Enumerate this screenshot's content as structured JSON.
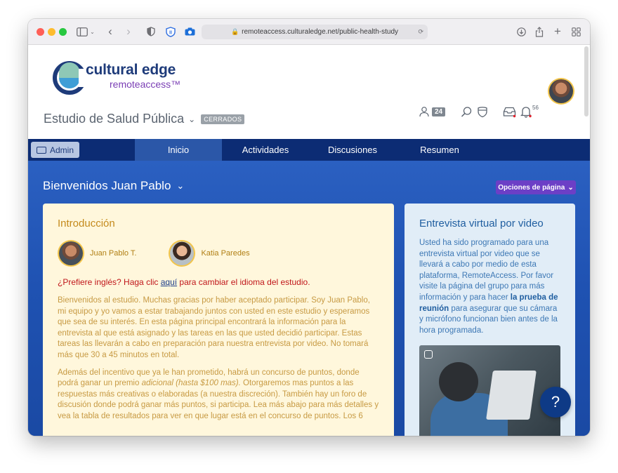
{
  "browser": {
    "url": "remoteaccess.culturaledge.net/public-health-study"
  },
  "header": {
    "logo_title": "cultural edge",
    "logo_subtitle": "remoteaccess™",
    "participants_count": "24",
    "notifications_count": "56",
    "study_title": "Estudio de Salud Pública",
    "study_status": "CERRADOS"
  },
  "nav": {
    "admin_label": "Admin",
    "tabs": [
      {
        "label": "Inicio",
        "active": true
      },
      {
        "label": "Actividades",
        "active": false
      },
      {
        "label": "Discusiones",
        "active": false
      },
      {
        "label": "Resumen",
        "active": false
      }
    ]
  },
  "main": {
    "welcome": "Bienvenidos Juan Pablo",
    "page_options": "Opciones de página"
  },
  "intro": {
    "title": "Introducción",
    "people": [
      {
        "name": "Juan Pablo T."
      },
      {
        "name": "Katia Paredes"
      }
    ],
    "lang_prefix": "¿Prefiere inglés? Haga clic ",
    "lang_link": "aquí",
    "lang_suffix": " para cambiar el idioma del estudio.",
    "para1": "Bienvenidos al estudio. Muchas gracias por haber aceptado participar. Soy Juan Pablo, mi equipo y yo vamos a estar trabajando juntos con usted en este estudio y esperamos que sea de su interés. En esta página principal encontrará la información para la entrevista al que está asignado y las tareas en las que usted decidió participar. Estas tareas las llevarán a cabo en preparación para nuestra entrevista por video. No tomará más que 30 a 45 minutos en total.",
    "para2_a": "Además del incentivo que ya le han prometido, habrá un concurso de puntos, donde podrá ganar un premio ",
    "para2_italic": "adicional (hasta $100 mas).",
    "para2_b": " Otorgaremos mas puntos a las respuestas más creativas o elaboradas (a nuestra discreción). También hay un foro de discusión donde podrá ganar más puntos, si participa.  Lea más abajo para más detalles y vea la tabla de resultados para ver en que lugar está en el concurso de puntos. Los 6"
  },
  "video_card": {
    "title": "Entrevista virtual por video",
    "text_a": "Usted ha sido programado para una entrevista virtual por video que se llevará a cabo por medio de esta plataforma, RemoteAccess. Por favor visite la página del grupo para más información y para hacer ",
    "text_bold": "la prueba de reunión",
    "text_b": " para asegurar que su cámara y micrófono funcionan bien antes de la hora programada."
  },
  "help": {
    "label": "?"
  },
  "colors": {
    "nav_bg": "#0c2c74",
    "intro_bg": "#fff7dc",
    "card_bg": "#e1edf7",
    "accent_purple": "#6c3fc6"
  }
}
